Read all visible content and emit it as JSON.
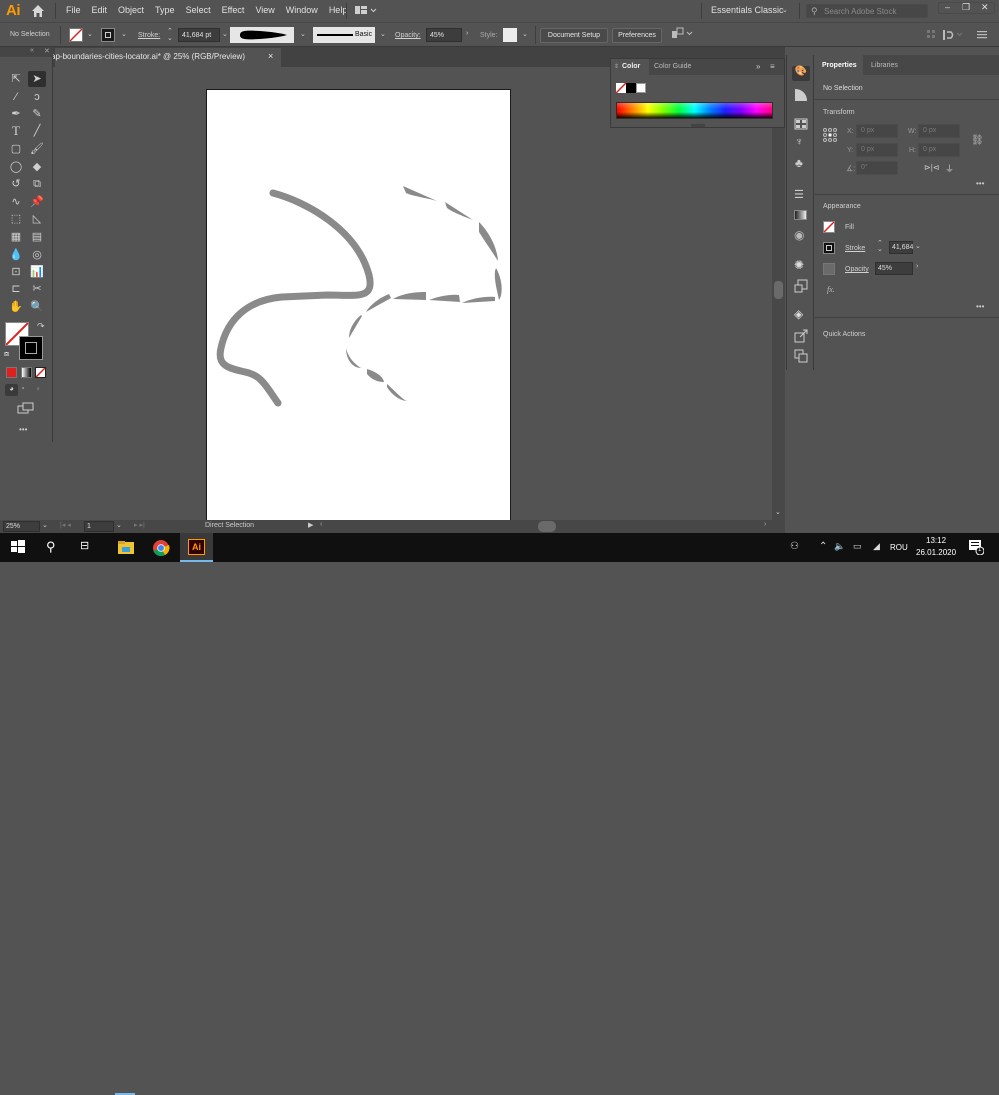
{
  "app": {
    "logo": "Ai",
    "menu": [
      "File",
      "Edit",
      "Object",
      "Type",
      "Select",
      "Effect",
      "View",
      "Window",
      "Help"
    ],
    "workspace": "Essentials Classic",
    "search_placeholder": "Search Adobe Stock",
    "window_controls": [
      "minimize",
      "restore",
      "close"
    ]
  },
  "control_bar": {
    "selection_label": "No Selection",
    "stroke_label": "Stroke:",
    "stroke_value": "41,684 pt",
    "brush_profile": "Basic",
    "opacity_label": "Opacity:",
    "opacity_value": "45%",
    "style_label": "Style:",
    "document_setup": "Document Setup",
    "preferences": "Preferences"
  },
  "document": {
    "tab_title": "ap-boundaries-cities-locator.ai* @ 25% (RGB/Preview)",
    "close": "×"
  },
  "color_panel": {
    "tabs": [
      "Color",
      "Color Guide"
    ],
    "active_tab": "Color"
  },
  "properties_panel": {
    "tabs": [
      "Properties",
      "Libraries"
    ],
    "active_tab": "Properties",
    "selection": "No Selection",
    "transform": {
      "title": "Transform",
      "x_label": "X:",
      "x_value": "0 px",
      "y_label": "Y:",
      "y_value": "0 px",
      "w_label": "W:",
      "w_value": "0 px",
      "h_label": "H:",
      "h_value": "0 px",
      "angle_value": "0°"
    },
    "appearance": {
      "title": "Appearance",
      "fill_label": "Fill",
      "stroke_label": "Stroke",
      "stroke_value": "41,684",
      "opacity_label": "Opacity",
      "opacity_value": "45%",
      "fx_label": "fx."
    },
    "quick_actions": "Quick Actions",
    "more": "•••"
  },
  "status_bar": {
    "zoom": "25%",
    "artboard": "1",
    "tool": "Direct Selection"
  },
  "toolbar": {
    "more": "•••"
  },
  "taskbar": {
    "language": "ROU",
    "time": "13:12",
    "date": "26.01.2020",
    "notifications": "1",
    "ai_label": "Ai"
  },
  "colors": {
    "accent_orange": "#ff9a00",
    "ui_bg": "#535353",
    "artwork_gray": "#8a8a8a",
    "none_red": "#e0201e"
  }
}
